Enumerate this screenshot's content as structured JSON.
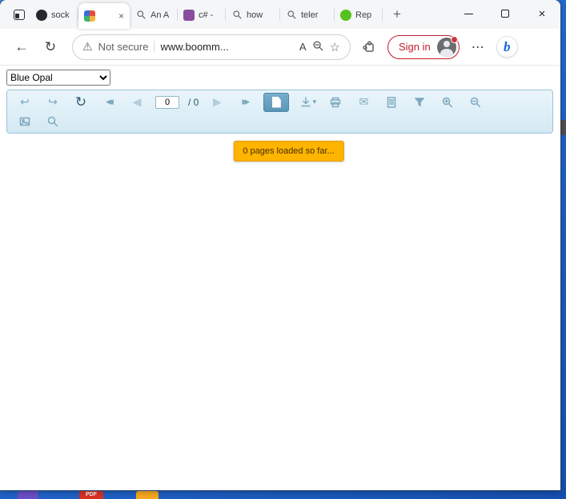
{
  "browser": {
    "tabs": [
      {
        "label": "sock",
        "icon": "github"
      },
      {
        "label": "",
        "icon": "app-colorful",
        "active": true
      },
      {
        "label": "An A",
        "icon": "search"
      },
      {
        "label": "c# -",
        "icon": "code-purple"
      },
      {
        "label": "how",
        "icon": "search"
      },
      {
        "label": "teler",
        "icon": "search"
      },
      {
        "label": "Rep",
        "icon": "telerik-green"
      }
    ],
    "new_tab": "+"
  },
  "navbar": {
    "not_secure": "Not secure",
    "url": "www.boomm...",
    "read_aloud": "A",
    "sign_in": "Sign in"
  },
  "viewer": {
    "theme": "Blue Opal",
    "page_current": "0",
    "page_total": "/ 0",
    "status": "0 pages loaded so far..."
  },
  "desktop": {
    "pdf_label": "PDF"
  },
  "icons": {
    "back": "←",
    "reload": "↻",
    "undo": "↩",
    "redo": "↪",
    "prev": "◀",
    "next": "▶",
    "caret_down": "▾",
    "mail": "✉",
    "star": "☆",
    "warning": "⚠",
    "more": "⋯",
    "close": "×",
    "copilot_b": "b"
  },
  "colors": {
    "toolbar_bg": "#d9ebf5",
    "toolbar_border": "#9cc2d7",
    "selected_tool": "#5a95b8",
    "badge_bg": "#ffb400",
    "signin_red": "#c11e2c",
    "desktop_blue": "#2063c8"
  }
}
